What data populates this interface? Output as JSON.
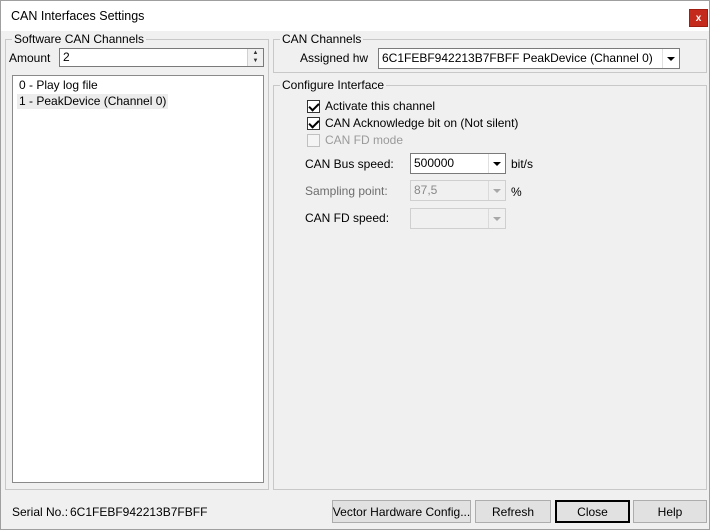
{
  "window": {
    "title": "CAN Interfaces Settings",
    "close_glyph": "x"
  },
  "software_channels": {
    "legend": "Software CAN Channels",
    "amount_label": "Amount",
    "amount_value": "2",
    "items": [
      {
        "label": "0 - Play log file"
      },
      {
        "label": "1 - PeakDevice (Channel 0)"
      }
    ]
  },
  "can_channels": {
    "legend": "CAN Channels",
    "assigned_label": "Assigned hw",
    "assigned_value": "6C1FEBF942213B7FBFF PeakDevice (Channel 0)"
  },
  "configure": {
    "legend": "Configure Interface",
    "activate_label": "Activate this channel",
    "activate_checked": true,
    "ack_label": "CAN Acknowledge bit on (Not silent)",
    "ack_checked": true,
    "fd_mode_label": "CAN FD mode",
    "fd_mode_checked": false,
    "bus_speed_label": "CAN Bus speed:",
    "bus_speed_value": "500000",
    "bus_speed_unit": "bit/s",
    "sampling_label": "Sampling point:",
    "sampling_value": "87,5",
    "sampling_unit": "%",
    "fd_speed_label": "CAN FD speed:",
    "fd_speed_value": ""
  },
  "footer": {
    "serial_label": "Serial No.:",
    "serial_value": "6C1FEBF942213B7FBFF",
    "vector_button": "Vector Hardware Config...",
    "refresh_button": "Refresh",
    "close_button": "Close",
    "help_button": "Help"
  },
  "colors": {
    "close_button_bg": "#c42b1c",
    "window_bg": "#f0f0f0"
  }
}
